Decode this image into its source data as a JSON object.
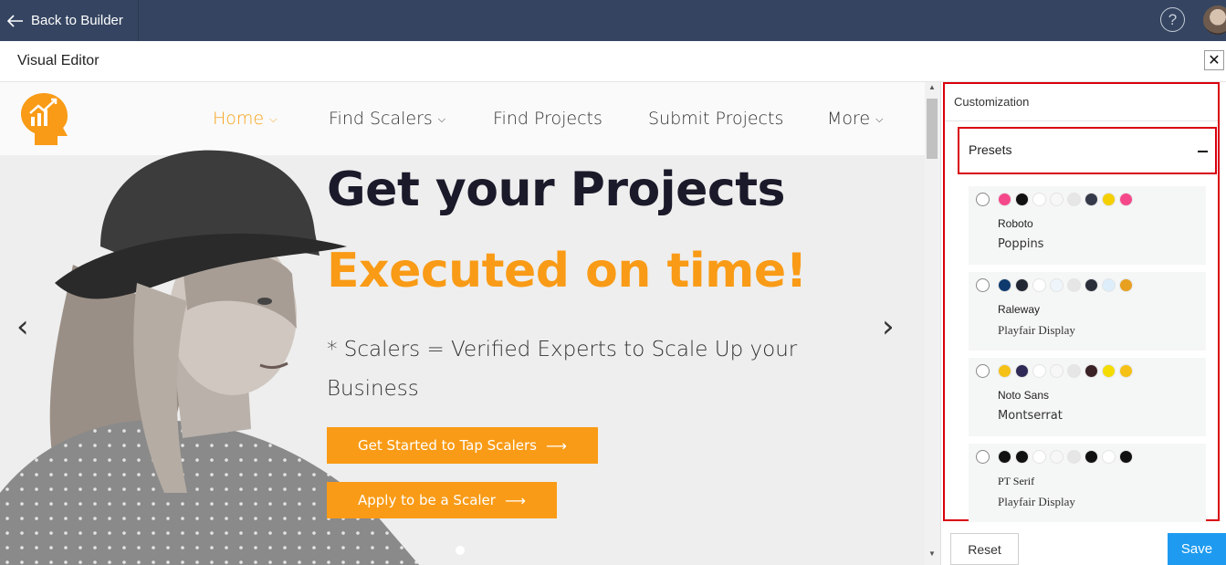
{
  "topbar": {
    "back_label": "Back to Builder",
    "help_icon": "?"
  },
  "editor": {
    "title": "Visual Editor",
    "close_icon": "✕"
  },
  "site": {
    "nav": [
      {
        "label": "Home",
        "chevron": true,
        "active": true
      },
      {
        "label": "Find Scalers",
        "chevron": true,
        "active": false
      },
      {
        "label": "Find Projects",
        "chevron": false,
        "active": false
      },
      {
        "label": "Submit Projects",
        "chevron": false,
        "active": false
      },
      {
        "label": "More",
        "chevron": true,
        "active": false
      }
    ],
    "hero": {
      "heading": "Get your Projects",
      "heading_accent": "Executed on time!",
      "subtext": "* Scalers = Verified Experts to Scale Up your Business",
      "cta_primary": "Get Started to Tap Scalers",
      "cta_secondary": "Apply to be a Scaler",
      "prev_arrow": "‹",
      "next_arrow": "›"
    },
    "colors": {
      "accent": "#f99b16",
      "dark": "#1a1a2a"
    }
  },
  "panel": {
    "title": "Customization",
    "presets_label": "Presets",
    "presets": [
      {
        "font1": "Roboto",
        "font2": "Poppins",
        "font1_family": "sans",
        "font2_family": "sans",
        "colors": [
          "#f5488a",
          "#111111",
          "#ffffff",
          "#f7f7f7",
          "#e6e6e6",
          "#353a4a",
          "#f5d000",
          "#f5488a"
        ]
      },
      {
        "font1": "Raleway",
        "font2": "Playfair Display",
        "font1_family": "sans",
        "font2_family": "serif",
        "colors": [
          "#0e3a6e",
          "#222833",
          "#ffffff",
          "#eef6fb",
          "#e6e6e6",
          "#2a2f3a",
          "#ddeefa",
          "#e7a020"
        ]
      },
      {
        "font1": "Noto Sans",
        "font2": "Montserrat",
        "font1_family": "sans",
        "font2_family": "sans",
        "colors": [
          "#f5c116",
          "#2e2a55",
          "#ffffff",
          "#f7f7f7",
          "#e6e6e6",
          "#3a2226",
          "#f5dc00",
          "#f5c116"
        ]
      },
      {
        "font1": "PT Serif",
        "font2": "Playfair Display",
        "font1_family": "serif",
        "font2_family": "serif",
        "colors": [
          "#111111",
          "#111111",
          "#ffffff",
          "#f7f7f7",
          "#e6e6e6",
          "#111111",
          "#ffffff",
          "#111111"
        ]
      }
    ],
    "reset_label": "Reset",
    "save_label": "Save"
  }
}
